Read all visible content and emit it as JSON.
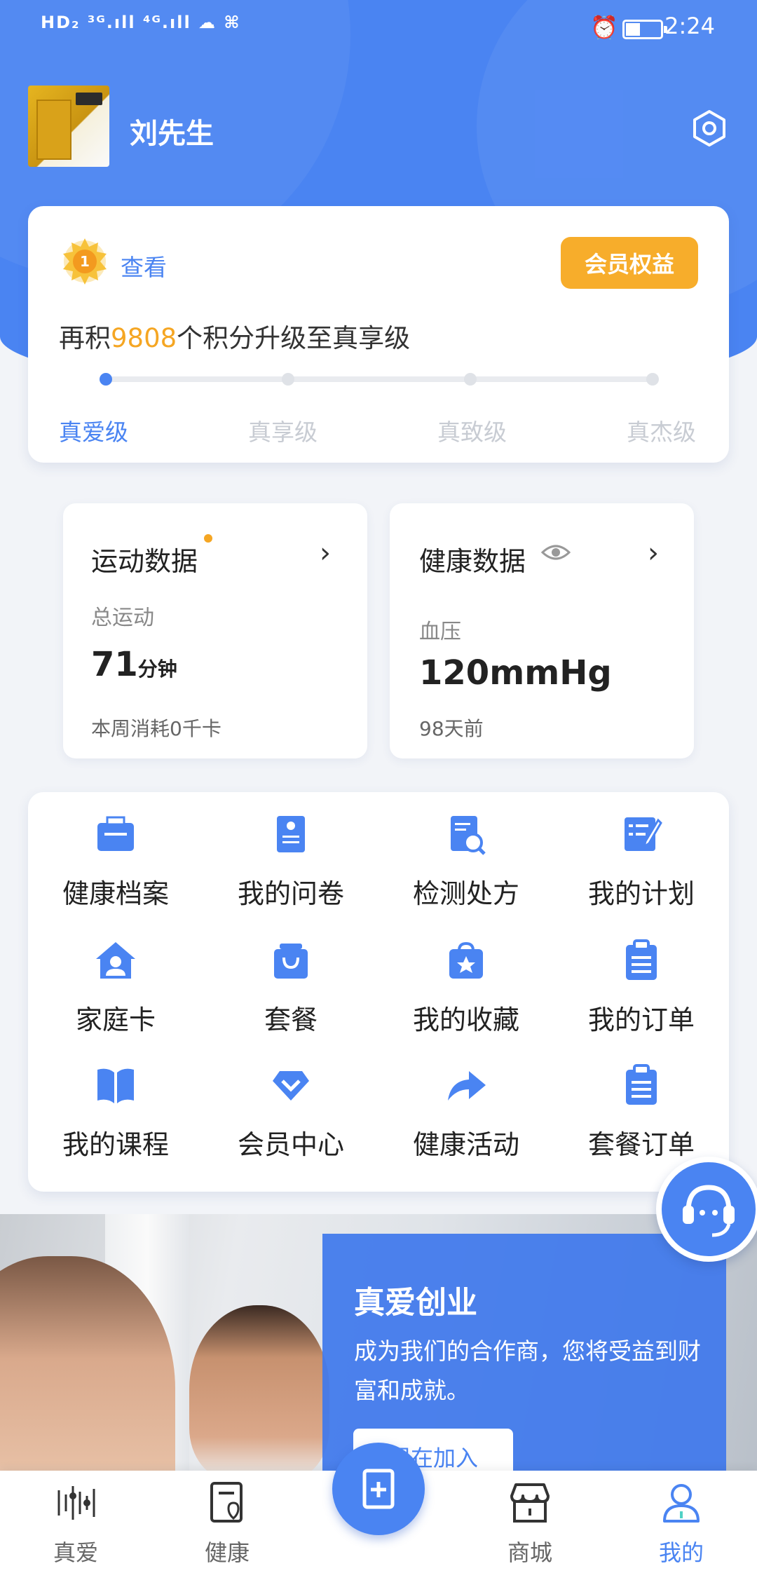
{
  "status_bar": {
    "left": "HD₂ ³ᴳ.ıll ⁴ᴳ.ıll ☁ ⌘",
    "time": "2:24"
  },
  "profile": {
    "name": "刘先生"
  },
  "member": {
    "level_badge": "1",
    "view_label": "查看",
    "benefits_label": "会员权益",
    "points_prefix": "再积",
    "points_needed": "9808",
    "points_suffix": "个积分升级至真享级",
    "progress": 0.0,
    "levels": [
      "真爱级",
      "真享级",
      "真致级",
      "真杰级"
    ],
    "current_level_index": 0
  },
  "sport": {
    "title": "运动数据",
    "label": "总运动",
    "value": "71",
    "unit": "分钟",
    "footnote": "本周消耗0千卡"
  },
  "health": {
    "title": "健康数据",
    "label": "血压",
    "value": "120mmHg",
    "footnote": "98天前"
  },
  "grid": [
    {
      "label": "健康档案",
      "icon": "folder-icon"
    },
    {
      "label": "我的问卷",
      "icon": "questionnaire-icon"
    },
    {
      "label": "检测处方",
      "icon": "prescription-icon"
    },
    {
      "label": "我的计划",
      "icon": "plan-icon"
    },
    {
      "label": "家庭卡",
      "icon": "family-card-icon"
    },
    {
      "label": "套餐",
      "icon": "package-icon"
    },
    {
      "label": "我的收藏",
      "icon": "favorite-icon"
    },
    {
      "label": "我的订单",
      "icon": "order-icon"
    },
    {
      "label": "我的课程",
      "icon": "course-icon"
    },
    {
      "label": "会员中心",
      "icon": "member-center-icon"
    },
    {
      "label": "健康活动",
      "icon": "activity-icon"
    },
    {
      "label": "套餐订单",
      "icon": "package-order-icon"
    }
  ],
  "banner": {
    "title": "真爱创业",
    "text": "成为我们的合作商，您将受益到财富和成就。",
    "button": "现在加入"
  },
  "tabs": [
    {
      "label": "真爱",
      "icon": "zhenai-icon"
    },
    {
      "label": "健康",
      "icon": "health-icon"
    },
    {
      "label": "",
      "icon": "center-add-icon"
    },
    {
      "label": "商城",
      "icon": "mall-icon"
    },
    {
      "label": "我的",
      "icon": "profile-icon"
    }
  ],
  "colors": {
    "primary": "#4a84f2",
    "accent": "#f7ad2b",
    "highlight": "#f5a623"
  }
}
